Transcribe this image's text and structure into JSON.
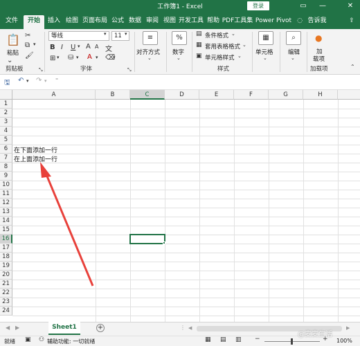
{
  "title_bar": {
    "title": "工作簿1 - Excel",
    "login": "登录",
    "minimize": "—",
    "close": "✕"
  },
  "tabs": [
    {
      "label": "文件"
    },
    {
      "label": "开始"
    },
    {
      "label": "插入"
    },
    {
      "label": "绘图"
    },
    {
      "label": "页面布局"
    },
    {
      "label": "公式"
    },
    {
      "label": "数据"
    },
    {
      "label": "审阅"
    },
    {
      "label": "视图"
    },
    {
      "label": "开发工具"
    },
    {
      "label": "帮助"
    },
    {
      "label": "PDF工具集"
    },
    {
      "label": "Power Pivot"
    },
    {
      "label": "告诉我"
    }
  ],
  "ribbon": {
    "clipboard": {
      "paste": "粘贴",
      "group": "剪贴板"
    },
    "font": {
      "name": "等线",
      "size": "11",
      "group": "字体"
    },
    "alignment": {
      "label": "对齐方式"
    },
    "number": {
      "label": "数字",
      "symbol": "%"
    },
    "styles": {
      "conditional": "条件格式",
      "table": "套用表格格式",
      "cell_styles": "单元格样式",
      "group": "样式"
    },
    "cells": {
      "label": "单元格"
    },
    "editing": {
      "label": "编辑"
    },
    "addins": {
      "label_1": "加",
      "label_2": "载项",
      "group": "加载项"
    }
  },
  "grid": {
    "columns": [
      "A",
      "B",
      "C",
      "D",
      "E",
      "F",
      "G",
      "H"
    ],
    "rows": [
      "1",
      "2",
      "3",
      "4",
      "5",
      "6",
      "7",
      "8",
      "9",
      "10",
      "11",
      "12",
      "13",
      "14",
      "15",
      "16",
      "17",
      "18",
      "19",
      "20",
      "21",
      "22",
      "23",
      "24"
    ],
    "selected_column": "C",
    "selected_row": "16",
    "cells": {
      "A6": "在下面添加一行",
      "A7": "在上面添加一行"
    }
  },
  "sheet": {
    "tab": "Sheet1",
    "add": "+"
  },
  "status": {
    "ready": "就绪",
    "accessibility": "辅助功能: 一切就绪",
    "zoom": "100%",
    "watermark": "@麦麦生活"
  },
  "colors": {
    "accent": "#217346",
    "arrow": "#e8413b"
  }
}
